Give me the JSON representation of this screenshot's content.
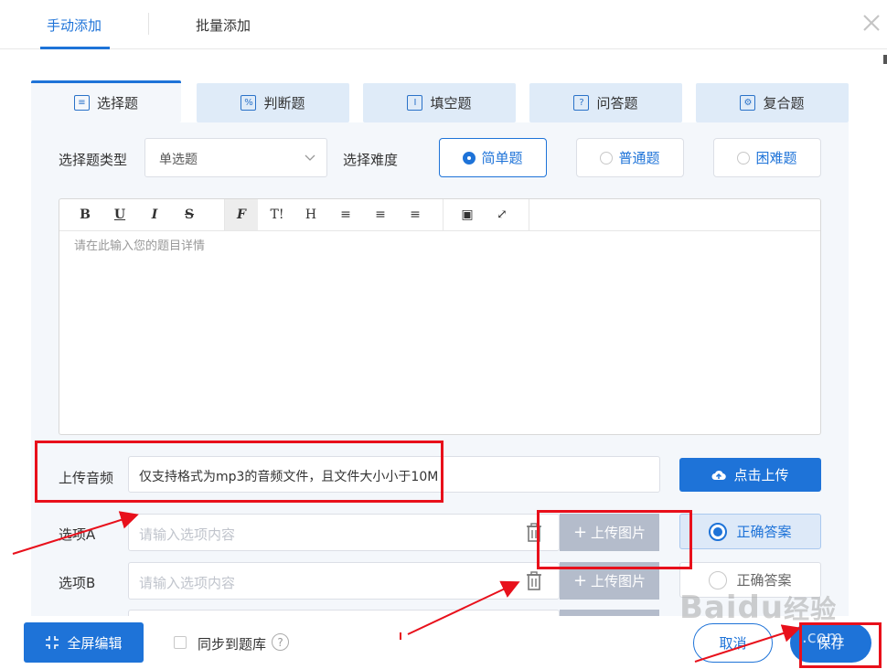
{
  "top_tabs": {
    "manual": "手动添加",
    "batch": "批量添加"
  },
  "question_tabs": [
    {
      "label": "选择题",
      "icon": "list-icon",
      "glyph": "≡"
    },
    {
      "label": "判断题",
      "icon": "percent-icon",
      "glyph": "%"
    },
    {
      "label": "填空题",
      "icon": "cursor-icon",
      "glyph": "I"
    },
    {
      "label": "问答题",
      "icon": "question-icon",
      "glyph": "?"
    },
    {
      "label": "复合题",
      "icon": "settings-list-icon",
      "glyph": "⚙"
    }
  ],
  "form": {
    "type_label": "选择题类型",
    "type_value": "单选题",
    "difficulty_label": "选择难度",
    "difficulty": [
      "简单题",
      "普通题",
      "困难题"
    ],
    "difficulty_selected": 0
  },
  "editor": {
    "toolbar": [
      "B",
      "U",
      "I",
      "S",
      "F",
      "T!",
      "H",
      "≡",
      "≡",
      "≡",
      "▣",
      "⤢"
    ],
    "placeholder": "请在此输入您的题目详情"
  },
  "audio": {
    "label": "上传音频",
    "value": "仅支持格式为mp3的音频文件，且文件大小小于10M",
    "upload_button": "点击上传"
  },
  "options": [
    {
      "label": "选项A",
      "placeholder": "请输入选项内容",
      "upload": "上传图片",
      "answer": "正确答案",
      "correct": true
    },
    {
      "label": "选项B",
      "placeholder": "请输入选项内容",
      "upload": "上传图片",
      "answer": "正确答案",
      "correct": false
    }
  ],
  "footer": {
    "fullscreen": "全屏编辑",
    "sync": "同步到题库",
    "cancel": "取消",
    "save": "保存"
  },
  "watermark": {
    "brand": "Baidu",
    "cn": "经验",
    "domain": ".com"
  },
  "colors": {
    "accent": "#1e73d8",
    "annotation": "#e8101b",
    "panel": "#f4f7fb",
    "tab_bg": "#dfebf8"
  }
}
